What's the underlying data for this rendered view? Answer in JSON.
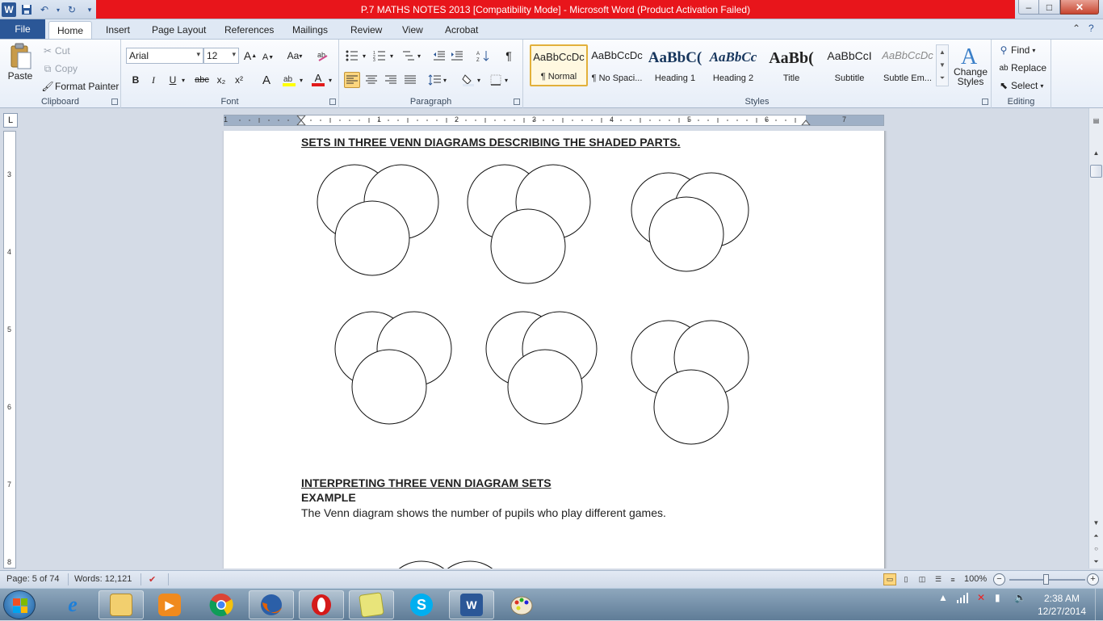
{
  "titlebar": {
    "title": "P.7 MATHS NOTES 2013 [Compatibility Mode]  -  Microsoft Word (Product Activation Failed)",
    "app_icon": "W",
    "minimize": "–",
    "maximize": "□",
    "close": "✕"
  },
  "tabs": {
    "file": "File",
    "items": [
      "Home",
      "Insert",
      "Page Layout",
      "References",
      "Mailings",
      "Review",
      "View",
      "Acrobat"
    ],
    "active": "Home"
  },
  "ribbon": {
    "clipboard": {
      "label": "Clipboard",
      "paste": "Paste",
      "cut": "Cut",
      "copy": "Copy",
      "format_painter": "Format Painter"
    },
    "font": {
      "label": "Font",
      "font_name": "Arial",
      "font_size": "12",
      "grow": "A",
      "shrink": "A",
      "change_case": "Aa",
      "bold": "B",
      "italic": "I",
      "underline": "U",
      "strikethrough": "abc",
      "subscript": "x₂",
      "superscript": "x²",
      "font_color": "A"
    },
    "paragraph": {
      "label": "Paragraph",
      "show_marks": "¶"
    },
    "styles": {
      "label": "Styles",
      "items": [
        {
          "sample": "AaBbCcDc",
          "name": "¶ Normal"
        },
        {
          "sample": "AaBbCcDc",
          "name": "¶ No Spaci..."
        },
        {
          "sample": "AaBbC(",
          "name": "Heading 1"
        },
        {
          "sample": "AaBbCc",
          "name": "Heading 2"
        },
        {
          "sample": "AaBb(",
          "name": "Title"
        },
        {
          "sample": "AaBbCcI",
          "name": "Subtitle"
        },
        {
          "sample": "AaBbCcDc",
          "name": "Subtle Em..."
        }
      ],
      "change_styles_1": "Change",
      "change_styles_2": "Styles"
    },
    "editing": {
      "label": "Editing",
      "find": "Find",
      "replace": "Replace",
      "select": "Select"
    }
  },
  "ruler": {
    "h_numbers": [
      "1",
      "1",
      "2",
      "3",
      "4",
      "5",
      "6",
      "7"
    ],
    "v_numbers": [
      "3",
      "4",
      "5",
      "6",
      "7",
      "8"
    ]
  },
  "document": {
    "heading1": "SETS IN THREE VENN DIAGRAMS DESCRIBING THE SHADED PARTS.",
    "heading2": "INTERPRETING THREE VENN DIAGRAM SETS ",
    "heading3": "EXAMPLE",
    "body": "The Venn diagram shows the number of pupils who play different games."
  },
  "statusbar": {
    "page": "Page: 5 of 74",
    "words": "Words: 12,121",
    "zoom": "100%"
  },
  "taskbar": {
    "clock_time": "2:38 AM",
    "clock_date": "12/27/2014"
  }
}
